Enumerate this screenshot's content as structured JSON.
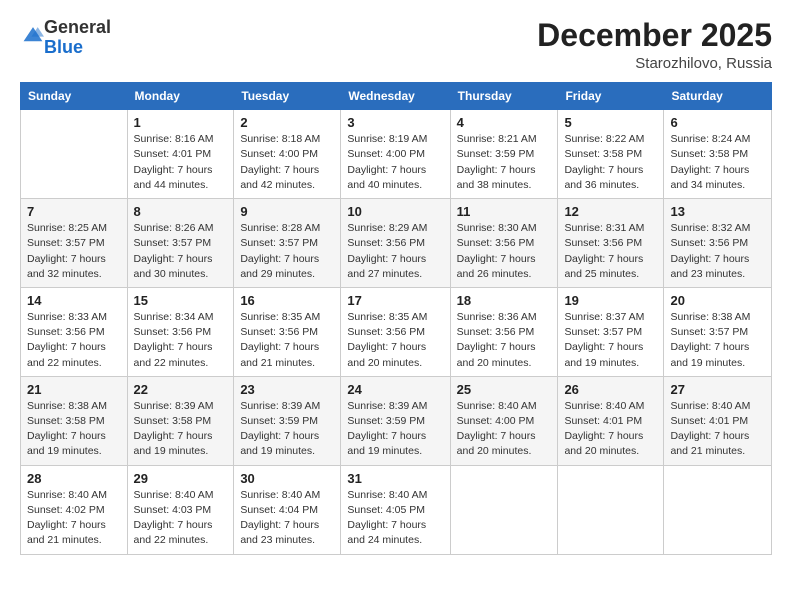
{
  "logo": {
    "general": "General",
    "blue": "Blue"
  },
  "header": {
    "month_year": "December 2025",
    "location": "Starozhilovo, Russia"
  },
  "days_of_week": [
    "Sunday",
    "Monday",
    "Tuesday",
    "Wednesday",
    "Thursday",
    "Friday",
    "Saturday"
  ],
  "weeks": [
    [
      {
        "day": "",
        "info": ""
      },
      {
        "day": "1",
        "info": "Sunrise: 8:16 AM\nSunset: 4:01 PM\nDaylight: 7 hours\nand 44 minutes."
      },
      {
        "day": "2",
        "info": "Sunrise: 8:18 AM\nSunset: 4:00 PM\nDaylight: 7 hours\nand 42 minutes."
      },
      {
        "day": "3",
        "info": "Sunrise: 8:19 AM\nSunset: 4:00 PM\nDaylight: 7 hours\nand 40 minutes."
      },
      {
        "day": "4",
        "info": "Sunrise: 8:21 AM\nSunset: 3:59 PM\nDaylight: 7 hours\nand 38 minutes."
      },
      {
        "day": "5",
        "info": "Sunrise: 8:22 AM\nSunset: 3:58 PM\nDaylight: 7 hours\nand 36 minutes."
      },
      {
        "day": "6",
        "info": "Sunrise: 8:24 AM\nSunset: 3:58 PM\nDaylight: 7 hours\nand 34 minutes."
      }
    ],
    [
      {
        "day": "7",
        "info": "Sunrise: 8:25 AM\nSunset: 3:57 PM\nDaylight: 7 hours\nand 32 minutes."
      },
      {
        "day": "8",
        "info": "Sunrise: 8:26 AM\nSunset: 3:57 PM\nDaylight: 7 hours\nand 30 minutes."
      },
      {
        "day": "9",
        "info": "Sunrise: 8:28 AM\nSunset: 3:57 PM\nDaylight: 7 hours\nand 29 minutes."
      },
      {
        "day": "10",
        "info": "Sunrise: 8:29 AM\nSunset: 3:56 PM\nDaylight: 7 hours\nand 27 minutes."
      },
      {
        "day": "11",
        "info": "Sunrise: 8:30 AM\nSunset: 3:56 PM\nDaylight: 7 hours\nand 26 minutes."
      },
      {
        "day": "12",
        "info": "Sunrise: 8:31 AM\nSunset: 3:56 PM\nDaylight: 7 hours\nand 25 minutes."
      },
      {
        "day": "13",
        "info": "Sunrise: 8:32 AM\nSunset: 3:56 PM\nDaylight: 7 hours\nand 23 minutes."
      }
    ],
    [
      {
        "day": "14",
        "info": "Sunrise: 8:33 AM\nSunset: 3:56 PM\nDaylight: 7 hours\nand 22 minutes."
      },
      {
        "day": "15",
        "info": "Sunrise: 8:34 AM\nSunset: 3:56 PM\nDaylight: 7 hours\nand 22 minutes."
      },
      {
        "day": "16",
        "info": "Sunrise: 8:35 AM\nSunset: 3:56 PM\nDaylight: 7 hours\nand 21 minutes."
      },
      {
        "day": "17",
        "info": "Sunrise: 8:35 AM\nSunset: 3:56 PM\nDaylight: 7 hours\nand 20 minutes."
      },
      {
        "day": "18",
        "info": "Sunrise: 8:36 AM\nSunset: 3:56 PM\nDaylight: 7 hours\nand 20 minutes."
      },
      {
        "day": "19",
        "info": "Sunrise: 8:37 AM\nSunset: 3:57 PM\nDaylight: 7 hours\nand 19 minutes."
      },
      {
        "day": "20",
        "info": "Sunrise: 8:38 AM\nSunset: 3:57 PM\nDaylight: 7 hours\nand 19 minutes."
      }
    ],
    [
      {
        "day": "21",
        "info": "Sunrise: 8:38 AM\nSunset: 3:58 PM\nDaylight: 7 hours\nand 19 minutes."
      },
      {
        "day": "22",
        "info": "Sunrise: 8:39 AM\nSunset: 3:58 PM\nDaylight: 7 hours\nand 19 minutes."
      },
      {
        "day": "23",
        "info": "Sunrise: 8:39 AM\nSunset: 3:59 PM\nDaylight: 7 hours\nand 19 minutes."
      },
      {
        "day": "24",
        "info": "Sunrise: 8:39 AM\nSunset: 3:59 PM\nDaylight: 7 hours\nand 19 minutes."
      },
      {
        "day": "25",
        "info": "Sunrise: 8:40 AM\nSunset: 4:00 PM\nDaylight: 7 hours\nand 20 minutes."
      },
      {
        "day": "26",
        "info": "Sunrise: 8:40 AM\nSunset: 4:01 PM\nDaylight: 7 hours\nand 20 minutes."
      },
      {
        "day": "27",
        "info": "Sunrise: 8:40 AM\nSunset: 4:01 PM\nDaylight: 7 hours\nand 21 minutes."
      }
    ],
    [
      {
        "day": "28",
        "info": "Sunrise: 8:40 AM\nSunset: 4:02 PM\nDaylight: 7 hours\nand 21 minutes."
      },
      {
        "day": "29",
        "info": "Sunrise: 8:40 AM\nSunset: 4:03 PM\nDaylight: 7 hours\nand 22 minutes."
      },
      {
        "day": "30",
        "info": "Sunrise: 8:40 AM\nSunset: 4:04 PM\nDaylight: 7 hours\nand 23 minutes."
      },
      {
        "day": "31",
        "info": "Sunrise: 8:40 AM\nSunset: 4:05 PM\nDaylight: 7 hours\nand 24 minutes."
      },
      {
        "day": "",
        "info": ""
      },
      {
        "day": "",
        "info": ""
      },
      {
        "day": "",
        "info": ""
      }
    ]
  ]
}
